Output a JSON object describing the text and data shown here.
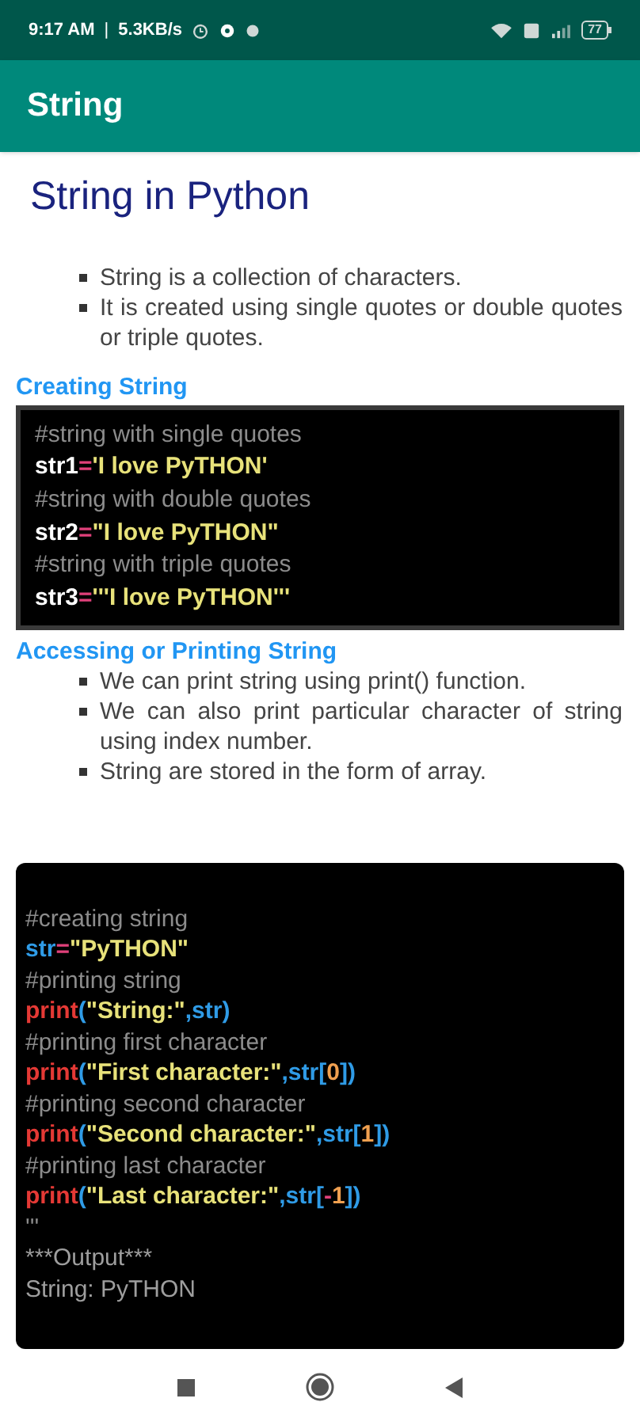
{
  "status_bar": {
    "time": "9:17 AM",
    "separator": "|",
    "speed": "5.3KB/s",
    "battery": "77"
  },
  "app_bar": {
    "title": "String"
  },
  "heading": "String in Python",
  "sections": [
    {
      "kind": "bullets",
      "items": [
        "String is a collection of characters.",
        "It is created using single quotes or double quotes or triple quotes."
      ]
    },
    {
      "kind": "subheading",
      "text": "Creating String"
    },
    {
      "kind": "code",
      "lines": [
        [
          {
            "kind": "comment",
            "text": "#string with single quotes"
          }
        ],
        [
          {
            "kind": "var",
            "text": "str1"
          },
          {
            "kind": "op",
            "text": "="
          },
          {
            "kind": "string",
            "text": "'I love PyTHON'"
          }
        ],
        [
          {
            "kind": "comment",
            "text": "#string with double quotes"
          }
        ],
        [
          {
            "kind": "var",
            "text": "str2"
          },
          {
            "kind": "op",
            "text": "="
          },
          {
            "kind": "string",
            "text": "\"I love PyTHON\""
          }
        ],
        [
          {
            "kind": "comment",
            "text": "#string with triple quotes"
          }
        ],
        [
          {
            "kind": "var",
            "text": "str3"
          },
          {
            "kind": "op",
            "text": "="
          },
          {
            "kind": "string",
            "text": "'''I love PyTHON'''"
          }
        ]
      ]
    },
    {
      "kind": "subheading",
      "text": "Accessing or Printing String"
    },
    {
      "kind": "bullets",
      "items": [
        "We can print string using print() function.",
        "We can also print particular character of string using index number.",
        "String are stored in the form of array."
      ]
    },
    {
      "kind": "code",
      "lines": [
        [
          {
            "kind": "comment",
            "text": "#creating string"
          }
        ],
        [
          {
            "kind": "ident",
            "text": "str"
          },
          {
            "kind": "op",
            "text": "="
          },
          {
            "kind": "string",
            "text": "\"PyTHON\""
          }
        ],
        [
          {
            "kind": "comment",
            "text": "#printing string"
          }
        ],
        [
          {
            "kind": "func",
            "text": "print"
          },
          {
            "kind": "ident",
            "text": "("
          },
          {
            "kind": "string",
            "text": "\"String:\""
          },
          {
            "kind": "ident",
            "text": ",str)"
          }
        ],
        [
          {
            "kind": "comment",
            "text": "#printing first character"
          }
        ],
        [
          {
            "kind": "func",
            "text": "print"
          },
          {
            "kind": "ident",
            "text": "("
          },
          {
            "kind": "string",
            "text": "\"First character:\""
          },
          {
            "kind": "ident",
            "text": ",str["
          },
          {
            "kind": "number",
            "text": "0"
          },
          {
            "kind": "ident",
            "text": "])"
          }
        ],
        [
          {
            "kind": "comment",
            "text": "#printing second character"
          }
        ],
        [
          {
            "kind": "func",
            "text": "print"
          },
          {
            "kind": "ident",
            "text": "("
          },
          {
            "kind": "string",
            "text": "\"Second character:\""
          },
          {
            "kind": "ident",
            "text": ",str["
          },
          {
            "kind": "number",
            "text": "1"
          },
          {
            "kind": "ident",
            "text": "])"
          }
        ],
        [
          {
            "kind": "comment",
            "text": "#printing last character"
          }
        ],
        [
          {
            "kind": "func",
            "text": "print"
          },
          {
            "kind": "ident",
            "text": "("
          },
          {
            "kind": "string",
            "text": "\"Last character:\""
          },
          {
            "kind": "ident",
            "text": ",str["
          },
          {
            "kind": "op",
            "text": "-"
          },
          {
            "kind": "number",
            "text": "1"
          },
          {
            "kind": "ident",
            "text": "])"
          }
        ],
        [
          {
            "kind": "comment",
            "text": "'''"
          }
        ],
        [
          {
            "kind": "output",
            "text": "***Output***"
          }
        ],
        [
          {
            "kind": "output",
            "text": "String: PyTHON"
          }
        ]
      ]
    }
  ]
}
